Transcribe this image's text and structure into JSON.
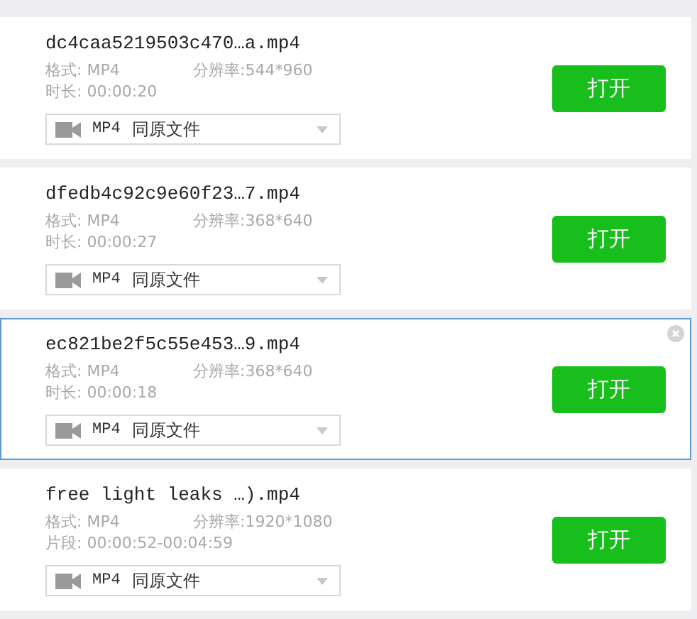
{
  "files": [
    {
      "name": "dc4caa5219503c470…a.mp4",
      "format": "格式: MP4",
      "resolution": "分辨率:544*960",
      "duration": "时长: 00:00:20",
      "output_format": "MP4",
      "output_option": "同原文件",
      "button": "打开",
      "selected": false
    },
    {
      "name": "dfedb4c92c9e60f23…7.mp4",
      "format": "格式: MP4",
      "resolution": "分辨率:368*640",
      "duration": "时长: 00:00:27",
      "output_format": "MP4",
      "output_option": "同原文件",
      "button": "打开",
      "selected": false
    },
    {
      "name": "ec821be2f5c55e453…9.mp4",
      "format": "格式: MP4",
      "resolution": "分辨率:368*640",
      "duration": "时长: 00:00:18",
      "output_format": "MP4",
      "output_option": "同原文件",
      "button": "打开",
      "selected": true
    },
    {
      "name": "free light leaks …).mp4",
      "format": "格式: MP4",
      "resolution": "分辨率:1920*1080",
      "duration": "片段: 00:00:52-00:04:59",
      "output_format": "MP4",
      "output_option": "同原文件",
      "button": "打开",
      "selected": false
    }
  ]
}
